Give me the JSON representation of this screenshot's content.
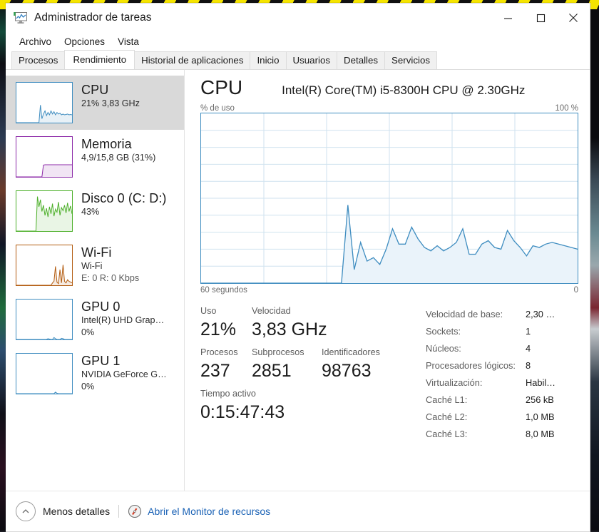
{
  "window": {
    "title": "Administrador de tareas",
    "icon": "task-manager-icon",
    "controls": {
      "minimize": "—",
      "maximize": "□",
      "close": "✕"
    }
  },
  "menu": {
    "items": [
      "Archivo",
      "Opciones",
      "Vista"
    ]
  },
  "tabs": {
    "items": [
      {
        "label": "Procesos",
        "active": false
      },
      {
        "label": "Rendimiento",
        "active": true
      },
      {
        "label": "Historial de aplicaciones",
        "active": false
      },
      {
        "label": "Inicio",
        "active": false
      },
      {
        "label": "Usuarios",
        "active": false
      },
      {
        "label": "Detalles",
        "active": false
      },
      {
        "label": "Servicios",
        "active": false
      }
    ]
  },
  "sidebar": {
    "items": [
      {
        "title": "CPU",
        "sub1": "21%  3,83 GHz",
        "sub2": "",
        "color": "#3f8dc0",
        "selected": true
      },
      {
        "title": "Memoria",
        "sub1": "4,9/15,8 GB (31%)",
        "sub2": "",
        "color": "#8c29a8",
        "selected": false
      },
      {
        "title": "Disco 0 (C: D:)",
        "sub1": "43%",
        "sub2": "",
        "color": "#4caf29",
        "selected": false
      },
      {
        "title": "Wi-Fi",
        "sub1": "Wi-Fi",
        "sub2": "E: 0 R: 0 Kbps",
        "color": "#b35c10",
        "selected": false
      },
      {
        "title": "GPU 0",
        "sub1": "Intel(R) UHD Grap…",
        "sub2": "0%",
        "color": "#3f8dc0",
        "selected": false
      },
      {
        "title": "GPU 1",
        "sub1": "NVIDIA GeForce G…",
        "sub2": "0%",
        "color": "#3f8dc0",
        "selected": false
      }
    ]
  },
  "main": {
    "title": "CPU",
    "model": "Intel(R) Core(TM) i5-8300H CPU @ 2.30GHz",
    "y_axis_label": "% de uso",
    "y_axis_max": "100 %",
    "x_axis_left": "60 segundos",
    "x_axis_right": "0",
    "stats": [
      {
        "label": "Uso",
        "value": "21%"
      },
      {
        "label": "Velocidad",
        "value": "3,83 GHz"
      },
      {
        "label": "Procesos",
        "value": "237"
      },
      {
        "label": "Subprocesos",
        "value": "2851"
      },
      {
        "label": "Identificadores",
        "value": "98763"
      },
      {
        "label": "Tiempo activo",
        "value": "0:15:47:43"
      }
    ],
    "specs": [
      {
        "key": "Velocidad de base:",
        "value": "2,30 …"
      },
      {
        "key": "Sockets:",
        "value": "1"
      },
      {
        "key": "Núcleos:",
        "value": "4"
      },
      {
        "key": "Procesadores lógicos:",
        "value": "8"
      },
      {
        "key": "Virtualización:",
        "value": "Habil…"
      },
      {
        "key": "Caché L1:",
        "value": "256 kB"
      },
      {
        "key": "Caché L2:",
        "value": "1,0 MB"
      },
      {
        "key": "Caché L3:",
        "value": "8,0 MB"
      }
    ]
  },
  "footer": {
    "less_details": "Menos detalles",
    "resource_monitor": "Abrir el Monitor de recursos"
  },
  "colors": {
    "accent": "#3f8dc0",
    "link": "#1961b5",
    "memory": "#8c29a8",
    "disk": "#4caf29",
    "wifi": "#b35c10",
    "selected_bg": "#d9d9d9"
  },
  "chart_data": {
    "type": "area",
    "title": "CPU",
    "subtitle": "% de uso",
    "xlabel": "60 segundos",
    "ylabel": "% de uso",
    "ylim": [
      0,
      100
    ],
    "xlim": [
      60,
      0
    ],
    "grid": true,
    "series": [
      {
        "name": "% de uso de CPU",
        "values": [
          0,
          0,
          0,
          0,
          0,
          0,
          0,
          0,
          0,
          0,
          0,
          0,
          0,
          0,
          0,
          0,
          0,
          0,
          0,
          0,
          0,
          0,
          0,
          46,
          8,
          24,
          13,
          15,
          11,
          20,
          32,
          23,
          23,
          33,
          26,
          21,
          19,
          22,
          19,
          21,
          24,
          32,
          17,
          17,
          23,
          25,
          21,
          20,
          31,
          25,
          21,
          16,
          22,
          21,
          23,
          24,
          23,
          22,
          21,
          20
        ]
      }
    ],
    "mini_graphs": [
      {
        "name": "CPU",
        "color": "#3f8dc0",
        "values": [
          0,
          0,
          0,
          0,
          0,
          0,
          0,
          0,
          0,
          0,
          0,
          0,
          0,
          0,
          0,
          0,
          45,
          10,
          22,
          30,
          18,
          26,
          20,
          30,
          22,
          28,
          20,
          26,
          22,
          24,
          20,
          22,
          20,
          21,
          22,
          20,
          21,
          20
        ]
      },
      {
        "name": "Memoria",
        "color": "#8c29a8",
        "values": [
          0,
          0,
          0,
          0,
          0,
          0,
          0,
          0,
          0,
          0,
          0,
          0,
          0,
          0,
          0,
          0,
          0,
          0,
          30,
          31,
          31,
          31,
          31,
          31,
          31,
          31,
          31,
          31,
          31,
          31,
          31,
          31,
          31,
          31,
          31,
          31,
          31,
          31
        ]
      },
      {
        "name": "Disco 0 (C: D:)",
        "color": "#4caf29",
        "values": [
          0,
          0,
          0,
          0,
          0,
          0,
          0,
          0,
          0,
          0,
          0,
          0,
          0,
          0,
          88,
          62,
          80,
          50,
          66,
          40,
          58,
          36,
          62,
          44,
          70,
          38,
          56,
          48,
          74,
          40,
          60,
          52,
          66,
          46,
          72,
          50,
          64,
          44
        ]
      },
      {
        "name": "Wi-Fi",
        "color": "#b35c10",
        "values": [
          0,
          0,
          0,
          0,
          0,
          0,
          0,
          0,
          0,
          0,
          0,
          0,
          0,
          0,
          0,
          0,
          0,
          0,
          0,
          0,
          0,
          0,
          0,
          0,
          6,
          10,
          48,
          8,
          4,
          40,
          6,
          52,
          10,
          6,
          14,
          10,
          8,
          6
        ]
      },
      {
        "name": "GPU 0",
        "color": "#3f8dc0",
        "values": [
          0,
          0,
          0,
          0,
          0,
          0,
          0,
          0,
          0,
          0,
          0,
          0,
          0,
          0,
          0,
          0,
          0,
          0,
          0,
          0,
          0,
          2,
          1,
          0,
          0,
          5,
          2,
          0,
          0,
          0,
          3,
          2,
          0,
          0,
          0,
          0,
          0,
          0
        ]
      },
      {
        "name": "GPU 1",
        "color": "#3f8dc0",
        "values": [
          0,
          0,
          0,
          0,
          0,
          0,
          0,
          0,
          0,
          0,
          0,
          0,
          0,
          0,
          0,
          0,
          0,
          0,
          0,
          0,
          0,
          0,
          0,
          0,
          0,
          0,
          4,
          1,
          0,
          0,
          0,
          0,
          0,
          0,
          0,
          0,
          0,
          0
        ]
      }
    ]
  }
}
